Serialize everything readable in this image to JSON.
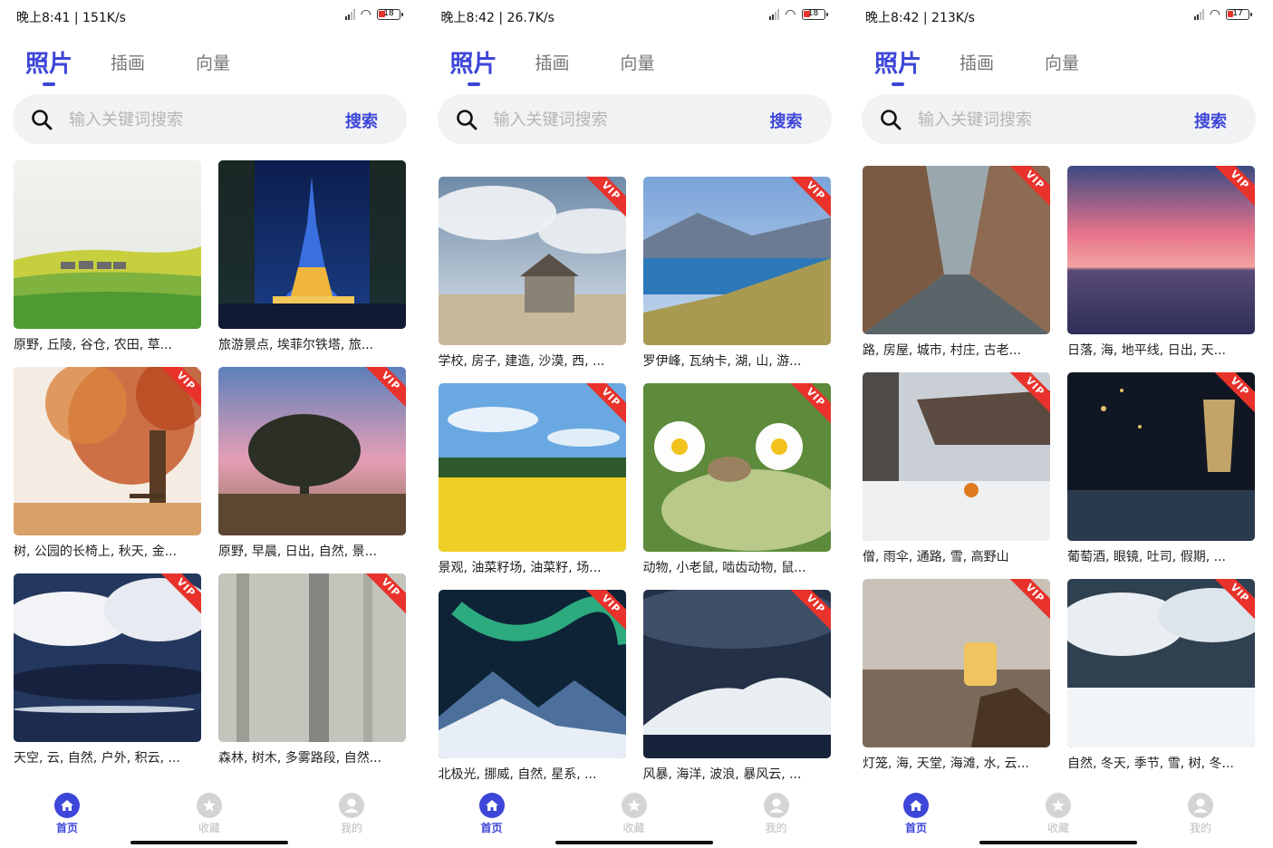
{
  "screens": [
    {
      "status": {
        "time": "晚上8:41 | 151K/s",
        "battery": "18"
      },
      "tabs": [
        {
          "label": "照片",
          "active": true
        },
        {
          "label": "插画",
          "active": false
        },
        {
          "label": "向量",
          "active": false
        }
      ],
      "search": {
        "placeholder": "输入关键词搜索",
        "button": "搜索"
      },
      "cards": [
        {
          "caption": "原野, 丘陵, 谷仓, 农田, 草...",
          "vip": false,
          "scene": "field"
        },
        {
          "caption": "旅游景点, 埃菲尔铁塔, 旅...",
          "vip": false,
          "scene": "eiffel"
        },
        {
          "caption": "树, 公园的长椅上, 秋天, 金...",
          "vip": true,
          "scene": "autumn"
        },
        {
          "caption": "原野, 早晨, 日出, 自然, 景...",
          "vip": true,
          "scene": "tree"
        },
        {
          "caption": "天空, 云, 自然, 户外, 积云, ...",
          "vip": true,
          "scene": "clouds"
        },
        {
          "caption": "森林, 树木, 多雾路段, 自然...",
          "vip": true,
          "scene": "fog"
        }
      ]
    },
    {
      "status": {
        "time": "晚上8:42 | 26.7K/s",
        "battery": "18"
      },
      "tabs": [
        {
          "label": "照片",
          "active": true
        },
        {
          "label": "插画",
          "active": false
        },
        {
          "label": "向量",
          "active": false
        }
      ],
      "search": {
        "placeholder": "输入关键词搜索",
        "button": "搜索"
      },
      "cards": [
        {
          "caption": "学校, 房子, 建造, 沙漠, 西, ...",
          "vip": true,
          "scene": "house"
        },
        {
          "caption": "罗伊峰, 瓦纳卡, 湖, 山, 游...",
          "vip": true,
          "scene": "lake"
        },
        {
          "caption": "景观, 油菜籽场, 油菜籽, 场...",
          "vip": true,
          "scene": "rapeseed"
        },
        {
          "caption": "动物, 小老鼠, 啮齿动物, 鼠...",
          "vip": true,
          "scene": "mouse"
        },
        {
          "caption": "北极光, 挪威, 自然, 星系, ...",
          "vip": true,
          "scene": "aurora"
        },
        {
          "caption": "风暴, 海洋, 波浪, 暴风云, ...",
          "vip": true,
          "scene": "storm"
        }
      ]
    },
    {
      "status": {
        "time": "晚上8:42 | 213K/s",
        "battery": "17"
      },
      "tabs": [
        {
          "label": "照片",
          "active": true
        },
        {
          "label": "插画",
          "active": false
        },
        {
          "label": "向量",
          "active": false
        }
      ],
      "search": {
        "placeholder": "输入关键词搜索",
        "button": "搜索"
      },
      "cards": [
        {
          "caption": "路, 房屋, 城市, 村庄, 古老...",
          "vip": true,
          "scene": "street"
        },
        {
          "caption": "日落, 海, 地平线, 日出, 天...",
          "vip": true,
          "scene": "sunset"
        },
        {
          "caption": "僧, 雨伞, 通路, 雪, 高野山",
          "vip": true,
          "scene": "temple"
        },
        {
          "caption": "葡萄酒, 眼镜, 吐司, 假期, ...",
          "vip": true,
          "scene": "wine"
        },
        {
          "caption": "灯笼, 海, 天堂, 海滩, 水, 云...",
          "vip": true,
          "scene": "lantern"
        },
        {
          "caption": "自然, 冬天, 季节, 雪, 树, 冬...",
          "vip": true,
          "scene": "snow"
        }
      ]
    }
  ],
  "vip_label": "VIP",
  "nav": [
    {
      "label": "首页",
      "icon": "home-icon",
      "active": true
    },
    {
      "label": "收藏",
      "icon": "star-icon",
      "active": false
    },
    {
      "label": "我的",
      "icon": "user-icon",
      "active": false
    }
  ],
  "colors": {
    "accent": "#3d46d8",
    "vip": "#e8322b",
    "search_bg": "#f1f2f4"
  }
}
